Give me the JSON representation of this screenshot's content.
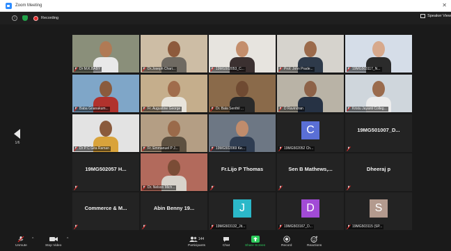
{
  "window": {
    "title": "Zoom Meeting"
  },
  "topbar": {
    "recording_label": "Recording",
    "speaker_view_label": "Speaker View"
  },
  "side_nav": {
    "page": "1/6"
  },
  "tiles": [
    {
      "label": "Dr M.K.BABY",
      "kind": "video",
      "bg": "#8a8f7a",
      "skin": "#b07a55",
      "shirt": "#e9e9e9"
    },
    {
      "label": "Dr.Joseph Chari...",
      "kind": "video",
      "bg": "#cdbda5",
      "skin": "#8d5a3c",
      "shirt": "#6f6a62"
    },
    {
      "label": "19MG502053_C...",
      "kind": "video",
      "bg": "#e7e4df",
      "skin": "#c48e6c",
      "shirt": "#3b3030"
    },
    {
      "label": "Prof. John Prade...",
      "kind": "video",
      "bg": "#d6d3cd",
      "skin": "#9b6a4b",
      "shirt": "#2e3a4a"
    },
    {
      "label": "19MG503117_N...",
      "kind": "video",
      "bg": "#d5dde8",
      "skin": "#d7a98c",
      "shirt": "#2b2b2b"
    },
    {
      "label": "Baba Gnanakum...",
      "kind": "video",
      "bg": "#7fa6c8",
      "skin": "#8a5b3d",
      "shirt": "#b0322d"
    },
    {
      "label": "Fr. Augustine George",
      "kind": "video",
      "bg": "#c5ae8c",
      "skin": "#a06c4c",
      "shirt": "#e8e4dc"
    },
    {
      "label": "Dr. Bala Senthil ...",
      "kind": "video",
      "bg": "#8a6a4a",
      "skin": "#6f4a32",
      "shirt": "#2a2a2a"
    },
    {
      "label": "D Ravindran",
      "kind": "video",
      "bg": "#b9b3a6",
      "skin": "#8d6248",
      "shirt": "#263244"
    },
    {
      "label": "Kristu Jayanti Colleg...",
      "kind": "video",
      "bg": "#cfd6dc",
      "skin": "#9a6b4d",
      "shirt": "#ededed",
      "speaking": true
    },
    {
      "label": "Dr P C Gita Raman",
      "kind": "video",
      "bg": "#e3e3e3",
      "skin": "#8a5a3c",
      "shirt": "#d9a33b"
    },
    {
      "label": "Fr. Emmanuel P J...",
      "kind": "video",
      "bg": "#b49e84",
      "skin": "#9a6a4a",
      "shirt": "#5d5040"
    },
    {
      "label": "19MG502069 Ke...",
      "kind": "video",
      "bg": "#6d7784",
      "skin": "#c08c6c",
      "shirt": "#2f3d52"
    },
    {
      "label": "19MG502052 Ch...",
      "kind": "avatar",
      "letter": "C",
      "color": "#5a6fd6"
    },
    {
      "label": "",
      "kind": "name",
      "center": "19MG501007_D..."
    },
    {
      "label": "",
      "kind": "name",
      "center": "19MG502057 H..."
    },
    {
      "label": "Dr. Nelson Mich...",
      "kind": "video",
      "bg": "#b26a5c",
      "skin": "#7a4c36",
      "shirt": "#d8d3cb"
    },
    {
      "label": "",
      "kind": "name",
      "center": "Fr.Lijo P Thomas"
    },
    {
      "label": "",
      "kind": "name",
      "center": "Sen B Mathews,..."
    },
    {
      "label": "",
      "kind": "name",
      "center": "Dheeraj p"
    },
    {
      "label": "",
      "kind": "name",
      "center": "Commerce & M..."
    },
    {
      "label": "",
      "kind": "name",
      "center": "Abin Benny 19..."
    },
    {
      "label": "19MG503132_Jit...",
      "kind": "avatar",
      "letter": "J",
      "color": "#2bb8c9"
    },
    {
      "label": "19MG503167_D...",
      "kind": "avatar",
      "letter": "D",
      "color": "#a24bd6"
    },
    {
      "label": "19MG503115 (SP...",
      "kind": "avatar",
      "letter": "S",
      "color": "#b39a8e"
    }
  ],
  "toolbar": {
    "unmute": "Unmute",
    "stop_video": "Stop Video",
    "participants": "Participants",
    "participants_count": "144",
    "chat": "Chat",
    "share_screen": "Share Screen",
    "record": "Record",
    "reactions": "Reactions"
  },
  "colors": {
    "speaking_outline": "#c8e619",
    "share_green": "#2dcc5c",
    "record_red": "#e02828"
  }
}
